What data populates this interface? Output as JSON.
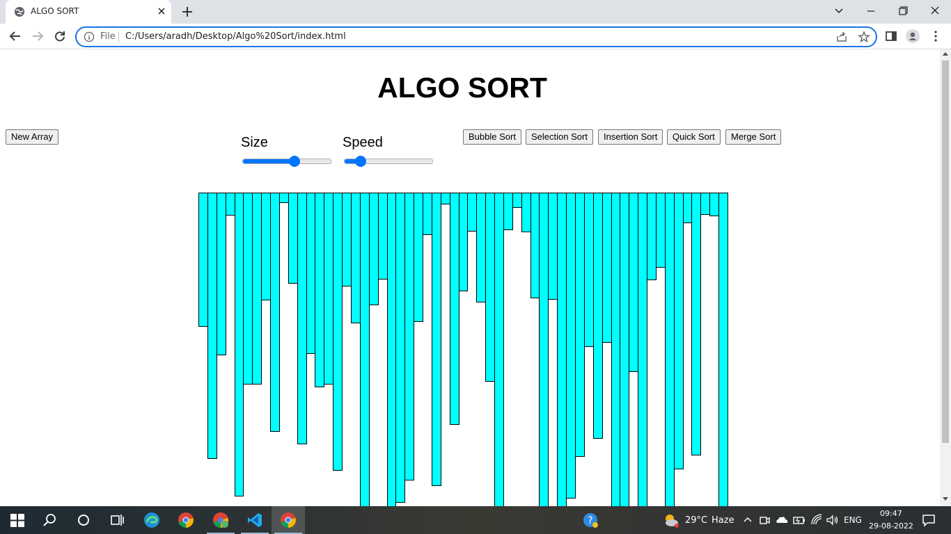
{
  "browser": {
    "tab_title": "ALGO SORT",
    "url_scheme_chip": "File",
    "url": "C:/Users/aradh/Desktop/Algo%20Sort/index.html"
  },
  "page": {
    "title": "ALGO SORT",
    "new_array_label": "New Array",
    "size_label": "Size",
    "speed_label": "Speed",
    "size_value_fraction": 0.59,
    "speed_value_fraction": 0.18,
    "sort_buttons": [
      "Bubble Sort",
      "Selection Sort",
      "Insertion Sort",
      "Quick Sort",
      "Merge Sort"
    ],
    "bar_color": "#00ffff",
    "bar_values": [
      193,
      383,
      234,
      33,
      437,
      276,
      276,
      155,
      344,
      15,
      131,
      362,
      232,
      280,
      276,
      400,
      135,
      188,
      460,
      162,
      125,
      460,
      446,
      414,
      186,
      61,
      422,
      17,
      334,
      142,
      56,
      158,
      272,
      460,
      54,
      22,
      57,
      152,
      460,
      154,
      460,
      440,
      380,
      222,
      354,
      216,
      460,
      460,
      258,
      460,
      126,
      108,
      460,
      398,
      44,
      378,
      32,
      34,
      460
    ],
    "bar_max": 460
  },
  "taskbar": {
    "weather_temp": "29°C",
    "weather_text": "Haze",
    "language": "ENG",
    "time": "09:47",
    "date": "29-08-2022"
  },
  "colors": {
    "accent": "#0075ff",
    "omnibox_border": "#1a73e8"
  }
}
